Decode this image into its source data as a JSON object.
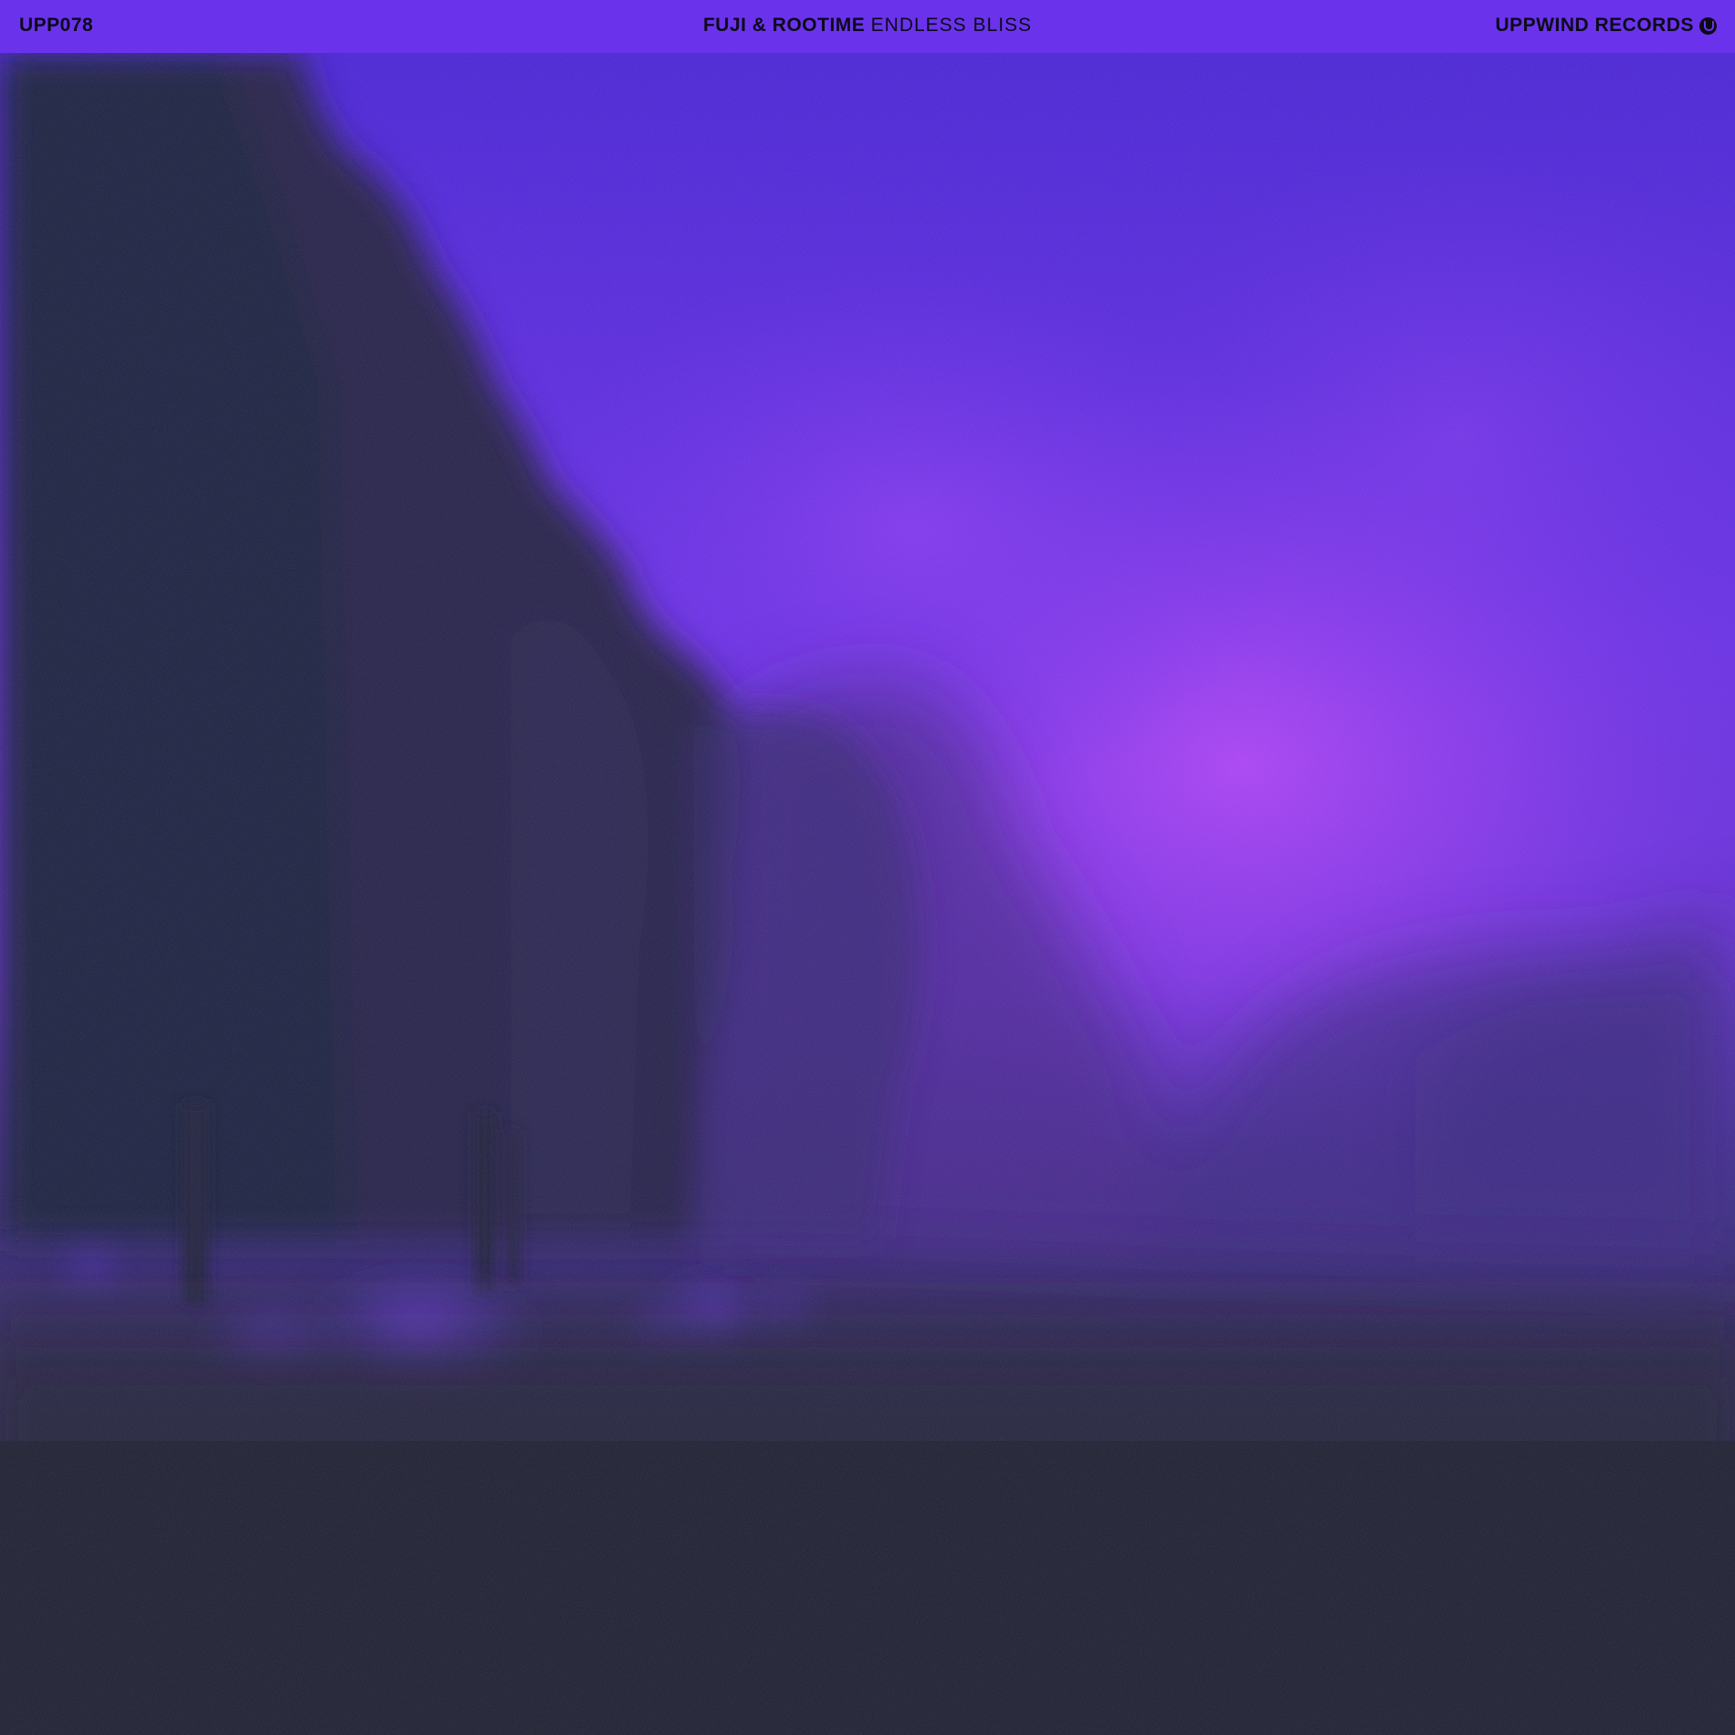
{
  "header": {
    "catalog_number": "UPP078",
    "artist": "FUJI & ROOTIME",
    "title": "ENDLESS BLISS",
    "label": "UPPWIND RECORDS",
    "logo_icon": "uppwind-logo-icon"
  },
  "colors": {
    "header_bg": "#6a33eb",
    "sky_bright": "#a340f5",
    "sky_deep": "#4e26d9",
    "ground_dark": "#1f2132",
    "text": "#0c0a1a"
  }
}
